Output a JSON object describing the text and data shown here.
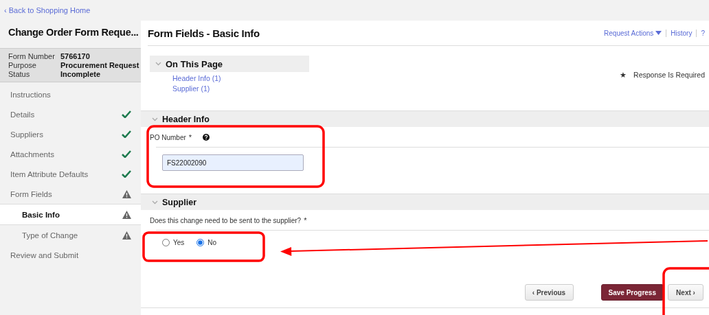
{
  "back_link": {
    "icon": "‹",
    "label": "Back to Shopping Home"
  },
  "sidebar": {
    "title": "Change Order Form Reque...",
    "info": [
      {
        "label": "Form Number",
        "value": "5766170"
      },
      {
        "label": "Purpose",
        "value": "Procurement Request"
      },
      {
        "label": "Status",
        "value": "Incomplete"
      }
    ],
    "items": [
      {
        "label": "Instructions",
        "kind": "plain",
        "selected": false
      },
      {
        "label": "Details",
        "kind": "done",
        "selected": false
      },
      {
        "label": "Suppliers",
        "kind": "done",
        "selected": false
      },
      {
        "label": "Attachments",
        "kind": "done",
        "selected": false
      },
      {
        "label": "Item Attribute Defaults",
        "kind": "done",
        "selected": false
      },
      {
        "label": "Form Fields",
        "kind": "warning",
        "selected": false,
        "children": [
          {
            "label": "Basic Info",
            "kind": "warning",
            "selected": true
          },
          {
            "label": "Type of Change",
            "kind": "warning",
            "selected": false
          }
        ]
      },
      {
        "label": "Review and Submit",
        "kind": "plain",
        "selected": false
      }
    ]
  },
  "main": {
    "title": "Form Fields - Basic Info",
    "header_links": [
      {
        "label": "Request Actions",
        "dropdown": true
      },
      {
        "label": "History",
        "dropdown": false
      },
      {
        "label": "?",
        "dropdown": false
      }
    ],
    "on_this_page": {
      "title": "On This Page",
      "links": [
        "Header Info (1)",
        "Supplier (1)"
      ]
    },
    "required_note": {
      "mark": "★",
      "label": "Response Is Required"
    },
    "sections": [
      {
        "title": "Header Info",
        "kind": "text",
        "field_label": "PO Number",
        "required_mark": "*",
        "help": true,
        "value": "FS22002090"
      },
      {
        "title": "Supplier",
        "kind": "radio",
        "field_label": "Does this change need to be sent to the supplier?",
        "required_mark": "*",
        "options": [
          {
            "label": "Yes",
            "selected": false
          },
          {
            "label": "No",
            "selected": true
          }
        ]
      }
    ],
    "buttons": [
      {
        "label": "Previous",
        "kind": "prev",
        "icon": "‹"
      },
      {
        "label": "Save Progress",
        "kind": "primary"
      },
      {
        "label": "Next",
        "kind": "next",
        "icon": "›"
      }
    ]
  }
}
